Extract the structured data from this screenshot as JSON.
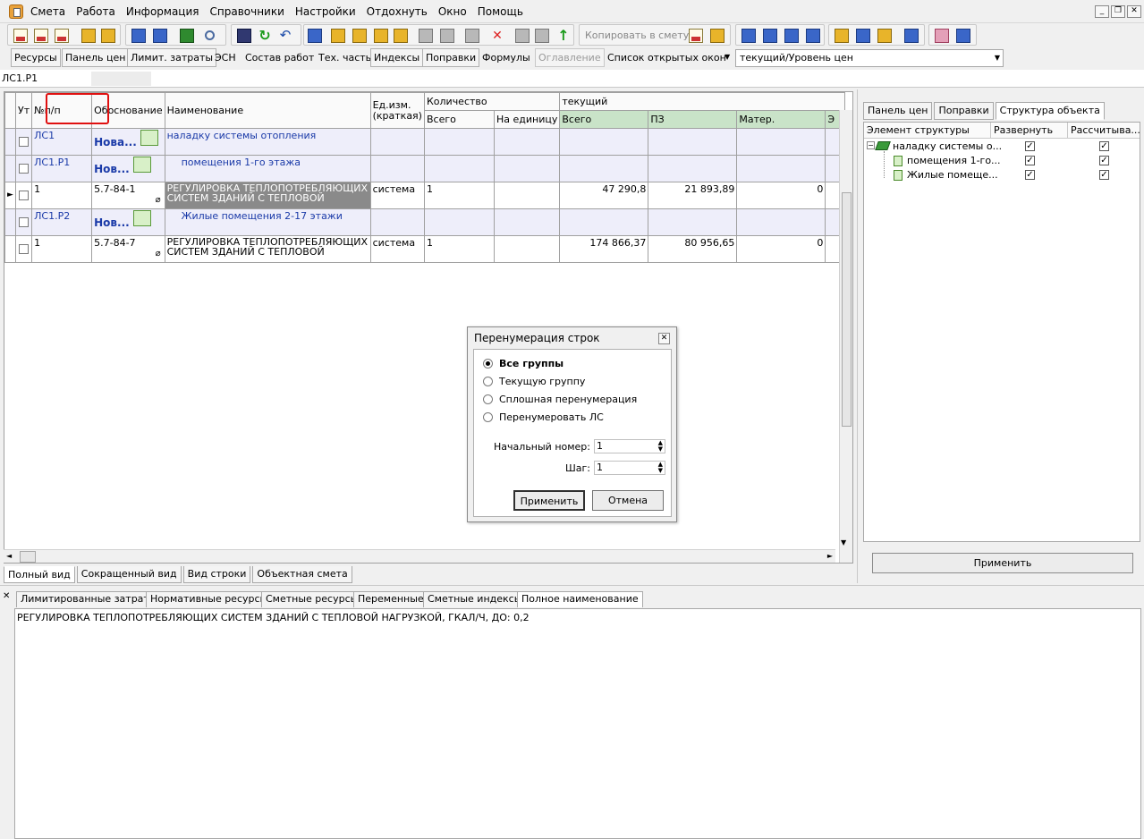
{
  "menu": [
    "Смета",
    "Работа",
    "Информация",
    "Справочники",
    "Настройки",
    "Отдохнуть",
    "Окно",
    "Помощь"
  ],
  "toolbar": {
    "copy_to_estimate": "Копировать в смету"
  },
  "tabs2": [
    {
      "label": "Ресурсы",
      "style": "btn"
    },
    {
      "label": "Панель цен",
      "style": "btn"
    },
    {
      "label": "Лимит. затраты",
      "style": "btn"
    },
    {
      "label": "ЭСН",
      "style": "plain"
    },
    {
      "label": "Состав работ",
      "style": "plain"
    },
    {
      "label": "Тех. часть",
      "style": "plain"
    },
    {
      "label": "Индексы",
      "style": "btn"
    },
    {
      "label": "Поправки",
      "style": "btn"
    },
    {
      "label": "Формулы",
      "style": "plain"
    },
    {
      "label": "Оглавление",
      "style": "off"
    },
    {
      "label": "Список открытых окон",
      "style": "plain"
    }
  ],
  "level_combo": "текущий/Уровень цен",
  "path": "ЛС1.Р1",
  "grid": {
    "headers": {
      "ut": "Ут",
      "num": "№п/п",
      "basis": "Обоснование",
      "name": "Наименование",
      "unit": "Ед.изм. (краткая)",
      "qty": "Количество",
      "qty_total": "Всего",
      "qty_unit": "На единицу",
      "current": "текущий",
      "total": "Всего",
      "pz": "ПЗ",
      "mater": "Матер.",
      "e": "Э"
    },
    "rows": [
      {
        "type": "grp",
        "code": "ЛС1",
        "badge": "Нова...",
        "name": "наладку системы отопления"
      },
      {
        "type": "grp",
        "code": "ЛС1.Р1",
        "badge": "Нов...",
        "name": "помещения 1-го этажа"
      },
      {
        "type": "row",
        "num": "1",
        "basis": "5.7-84-1",
        "name": "РЕГУЛИРОВКА ТЕПЛОПОТРЕБЛЯЮЩИХ СИСТЕМ ЗДАНИЙ С ТЕПЛОВОЙ",
        "unit": "система",
        "qty": "1",
        "total": "47 290,8",
        "pz": "21 893,89",
        "mater": "0",
        "selected": true
      },
      {
        "type": "grp",
        "code": "ЛС1.Р2",
        "badge": "Нов...",
        "name": "Жилые помещения 2-17 этажи"
      },
      {
        "type": "row",
        "num": "1",
        "basis": "5.7-84-7",
        "name": "РЕГУЛИРОВКА ТЕПЛОПОТРЕБЛЯЮЩИХ СИСТЕМ ЗДАНИЙ С ТЕПЛОВОЙ",
        "unit": "система",
        "qty": "1",
        "total": "174 866,37",
        "pz": "80 956,65",
        "mater": "0",
        "selected": false
      }
    ]
  },
  "view_tabs": [
    "Полный вид",
    "Сокращенный вид",
    "Вид строки",
    "Объектная смета"
  ],
  "right_panel": {
    "tabs": [
      "Панель цен",
      "Поправки",
      "Структура объекта"
    ],
    "columns": [
      "Элемент структуры",
      "Развернуть",
      "Рассчитыва..."
    ],
    "items": [
      "наладку системы о...",
      "помещения 1-го...",
      "Жилые помеще..."
    ],
    "apply": "Применить"
  },
  "bottom_tabs": [
    "Лимитированные затраты",
    "Нормативные ресурсы",
    "Сметные ресурсы",
    "Переменные",
    "Сметные индексы",
    "Полное наименование"
  ],
  "full_name": "РЕГУЛИРОВКА ТЕПЛОПОТРЕБЛЯЮЩИХ СИСТЕМ ЗДАНИЙ С ТЕПЛОВОЙ НАГРУЗКОЙ, ГКАЛ/Ч, ДО: 0,2",
  "dialog": {
    "title": "Перенумерация строк",
    "options": [
      "Все группы",
      "Текущую группу",
      "Сплошная перенумерация",
      "Перенумеровать ЛС"
    ],
    "selected_option": "Все группы",
    "start_label": "Начальный номер:",
    "start_value": "1",
    "step_label": "Шаг:",
    "step_value": "1",
    "apply": "Применить",
    "cancel": "Отмена"
  }
}
